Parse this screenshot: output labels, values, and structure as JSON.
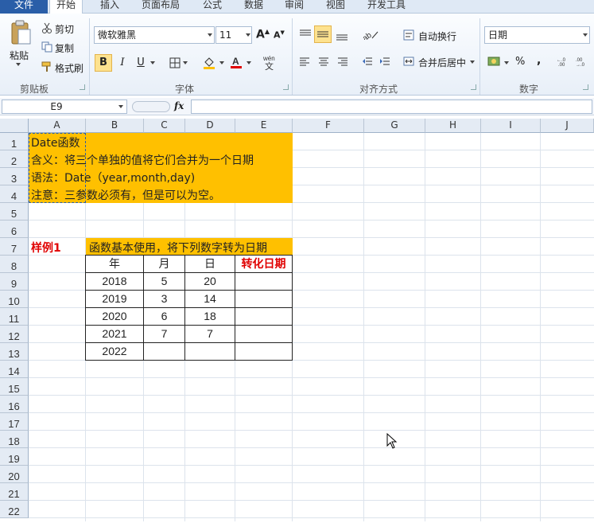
{
  "ribbon": {
    "tabs": [
      "文件",
      "开始",
      "插入",
      "页面布局",
      "公式",
      "数据",
      "审阅",
      "视图",
      "开发工具"
    ],
    "clipboard": {
      "paste": "粘贴",
      "cut": "剪切",
      "copy": "复制",
      "format_painter": "格式刷",
      "label": "剪贴板"
    },
    "font": {
      "name": "微软雅黑",
      "size": "11",
      "label": "字体",
      "bold": "B",
      "italic": "I",
      "underline": "U"
    },
    "alignment": {
      "wrap": "自动换行",
      "merge": "合并后居中",
      "label": "对齐方式"
    },
    "number": {
      "format": "日期",
      "percent": "%",
      "comma": ",",
      "label": "数字"
    }
  },
  "formula_bar": {
    "name_box": "E9",
    "fx": "fx",
    "content": ""
  },
  "columns": [
    "A",
    "B",
    "C",
    "D",
    "E",
    "F",
    "G",
    "H",
    "I",
    "J"
  ],
  "rows": [
    "1",
    "2",
    "3",
    "4",
    "5",
    "6",
    "7",
    "8",
    "9",
    "10",
    "11",
    "12",
    "13",
    "14",
    "15",
    "16",
    "17",
    "18",
    "19",
    "20",
    "21",
    "22"
  ],
  "info": {
    "line1": "Date函数",
    "line2": "含义：将三个单独的值将它们合并为一个日期",
    "line3": "语法：Date（year,month,day)",
    "line4": "注意：三参数必须有，但是可以为空。"
  },
  "example": {
    "label": "样例1",
    "title": "函数基本使用，将下列数字转为日期",
    "headers": [
      "年",
      "月",
      "日",
      "转化日期"
    ],
    "rows": [
      [
        "2018",
        "5",
        "20",
        ""
      ],
      [
        "2019",
        "3",
        "14",
        ""
      ],
      [
        "2020",
        "6",
        "18",
        ""
      ],
      [
        "2021",
        "7",
        "7",
        ""
      ],
      [
        "2022",
        "",
        "",
        ""
      ]
    ]
  },
  "colors": {
    "accent_orange": "#ffc000",
    "label_red": "#e00000",
    "file_tab": "#2a5ea8"
  }
}
